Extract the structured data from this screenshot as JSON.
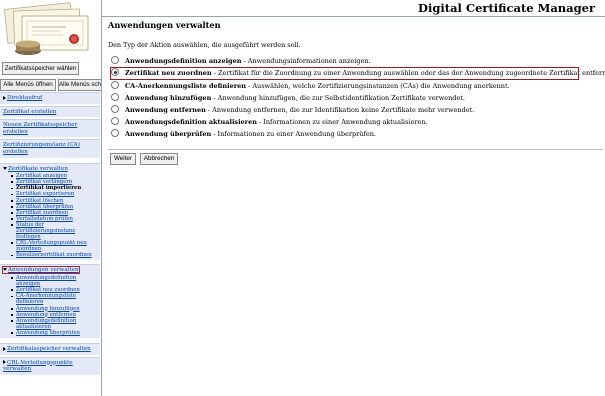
{
  "header": {
    "title": "Digital Certificate Manager"
  },
  "sidebar": {
    "store_button": "Zertifikatsspeicher wählen",
    "open_menus": "Alle Menüs öffnen",
    "close_menus": "Alle Menüs sch",
    "sections": {
      "direct_call": "Direktaufruf",
      "create_cert": "Zertifikat erstellen",
      "new_store": "Neuen Zertifikatsspeicher erstellen",
      "ca": "Zertifizierungsinstanz (CA) erstellen",
      "manage_certs": "Zertifikate verwalten",
      "manage_apps": "Anwendungen verwalten",
      "manage_store": "Zertifikatsspeicher verwalten",
      "crl": "CRL-Verteilungspunkte verwalten"
    },
    "cert_items": [
      "Zertifikat anzeigen",
      "Zertifikat verlängern",
      "Zertifikat importieren",
      "Zertifikat exportieren",
      "Zertifikat löschen",
      "Zertifikat überprüfen",
      "Zertifikat zuordnen",
      "Verfallsdatum prüfen",
      "Status der Zertifizierungsinstanz festlegen",
      "CRL-Verteilungspunkt neu zuordnen",
      "Benutzerzertifikat zuordnen"
    ],
    "app_items": [
      "Anwendungsdefinition anzeigen",
      "Zertifikat neu zuordnen",
      "CA-Anerkennungsliste definieren",
      "Anwendung hinzufügen",
      "Anwendung entfernen",
      "Anwendungsdefinition aktualisieren",
      "Anwendung überprüfen"
    ]
  },
  "main": {
    "title": "Anwendungen verwalten",
    "instruction": "Den Typ der Aktion auswählen, die ausgeführt werden soll.",
    "options": [
      {
        "name": "Anwendungsdefinition anzeigen",
        "desc": " - Anwendungsinformationen anzeigen.",
        "checked": false
      },
      {
        "name": "Zertifikat neu zuordnen",
        "desc": " - Zertifikat für die Zuordnung zu einer Anwendung auswählen oder das der Anwendung zugeordnete Zertifikat entfernen.",
        "checked": true
      },
      {
        "name": "CA-Anerkennungsliste definieren",
        "desc": " - Auswählen, welche Zertifizierungsinstanzen (CAs) die Anwendung anerkennt.",
        "checked": false
      },
      {
        "name": "Anwendung hinzufügen",
        "desc": " - Anwendung hinzufügen, die zur Selbstidentifikation Zertifikate verwendet.",
        "checked": false
      },
      {
        "name": "Anwendung entfernen",
        "desc": " - Anwendung entfernen, die zur Identifikation keine Zertifikate mehr verwendet.",
        "checked": false
      },
      {
        "name": "Anwendungsdefinition aktualisieren",
        "desc": " - Informationen zu einer Anwendung aktualisieren.",
        "checked": false
      },
      {
        "name": "Anwendung überprüfen",
        "desc": " - Informationen zu einer Anwendung überprüfen.",
        "checked": false
      }
    ],
    "buttons": {
      "next": "Weiter",
      "cancel": "Abbrechen"
    }
  },
  "colors": {
    "nav_bg": "#e3e9f6",
    "link": "#0645ad",
    "selection_border": "#a01828"
  }
}
